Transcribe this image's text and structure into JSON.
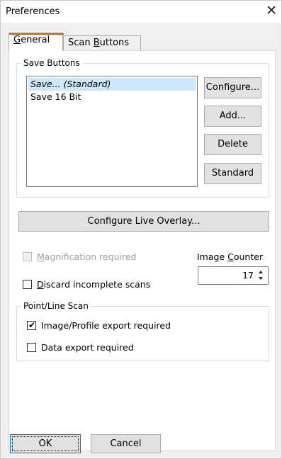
{
  "window": {
    "title": "Preferences",
    "close_icon": "close-icon"
  },
  "tabs": [
    {
      "label_pre": "",
      "label_u": "G",
      "label_post": "eneral",
      "active": true
    },
    {
      "label_pre": "Scan ",
      "label_u": "B",
      "label_post": "uttons",
      "active": false
    }
  ],
  "save_buttons": {
    "group_label": "Save Buttons",
    "items": [
      {
        "label": "Save... (Standard)",
        "selected": true
      },
      {
        "label": "Save 16 Bit",
        "selected": false
      }
    ],
    "configure_label": "Configure...",
    "add_label": "Add...",
    "delete_label": "Delete",
    "standard_label": "Standard"
  },
  "overlay_button_label": "Configure Live Overlay...",
  "magnification": {
    "label_u": "M",
    "label_post": "agnification required",
    "checked": false,
    "enabled": false
  },
  "discard": {
    "label_u": "D",
    "label_post": "iscard incomplete scans",
    "checked": false
  },
  "image_counter": {
    "label_pre": "Image ",
    "label_u": "C",
    "label_post": "ounter",
    "value": "17"
  },
  "point_line": {
    "group_label": "Point/Line Scan",
    "image_export": {
      "label": "Image/Profile export required",
      "checked": true
    },
    "data_export": {
      "label": "Data export required",
      "checked": false
    }
  },
  "footer": {
    "ok_label": "OK",
    "cancel_label": "Cancel"
  }
}
